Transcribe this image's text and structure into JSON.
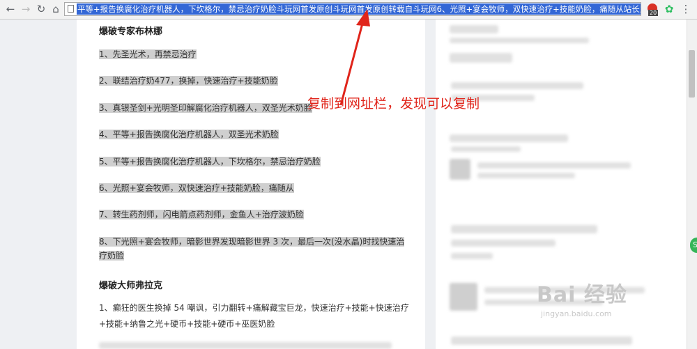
{
  "browser": {
    "url_selected_text": "平等+报告换腐化治疗机器人，下坎格尔，禁忌治疗奶脸斗玩网首发原创斗玩网首发原创转载自斗玩网6、光照+宴会牧师，双快速治疗+技能奶脸，痛随从站长之家，斗玩网站长",
    "extension_badge": "20",
    "icons": [
      "back-icon",
      "forward-icon",
      "reload-icon",
      "home-icon",
      "page-icon",
      "extension-red-icon",
      "evernote-icon",
      "menu-icon"
    ]
  },
  "article": {
    "section1_title": "爆破专家布林娜",
    "section1_items": [
      "1、先圣光术，再禁忌治疗",
      "2、联结治疗奶477，换掉，快速治疗+技能奶脸",
      "3、真银圣剑+光明圣印解腐化治疗机器人，双圣光术奶脸",
      "4、平等+报告换腐化治疗机器人，双圣光术奶脸",
      "5、平等+报告换腐化治疗机器人，下坎格尔，禁忌治疗奶脸",
      "6、光照+宴会牧师，双快速治疗+技能奶脸，痛随从",
      "7、转生药剂师，闪电箭点药剂师，金鱼人+治疗波奶脸",
      "8、下光照+宴会牧师，暗影世界发现暗影世界 3 次，最后一次(没水晶)时找快速治",
      "疗奶脸"
    ],
    "section2_title": "爆破大师弗拉克",
    "section2_item1_line1": "1、癫狂的医生换掉 54 嘲讽，引力翻转+痛解藏宝巨龙，快速治疗+技能+快速治疗",
    "section2_item1_line2": "+技能+纳鲁之光+硬币+技能+硬币+巫医奶脸"
  },
  "annotation": {
    "text": "复制到网址栏，发现可以复制",
    "color": "#e0241a"
  },
  "watermark": {
    "logo": "Bai 经验",
    "sub": "jingyan.baidu.com"
  },
  "colors": {
    "selection": "#3367d6",
    "highlight": "#cfcfcf",
    "annotation_red": "#e0241a",
    "side_tab_green": "#35b558"
  }
}
